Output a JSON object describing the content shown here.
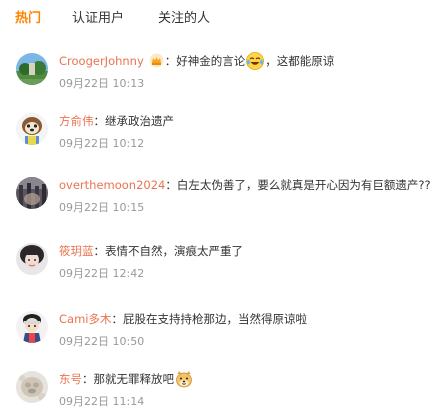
{
  "tabs": [
    {
      "label": "热门",
      "active": true
    },
    {
      "label": "认证用户",
      "active": false
    },
    {
      "label": "关注的人",
      "active": false
    }
  ],
  "comments": [
    {
      "username": "CroogerJohnny",
      "colon": "：",
      "text_before": "好神金的言论",
      "text_after": "，这都能原谅",
      "badge_icon": "crown-badge-icon",
      "emoji_icon": "laughing-tears-emoji-icon",
      "time": "09月22日 10:13"
    },
    {
      "username": "方俞伟",
      "colon": "：",
      "text_before": "继承政治遗产",
      "time": "09月22日 10:12"
    },
    {
      "username": "overthemoon2024",
      "colon": "：",
      "text_before": "白左太伪善了，要么就真是开心因为有巨额遗产??",
      "time": "09月22日 10:15"
    },
    {
      "username": "筱玥蓝",
      "colon": "：",
      "text_before": "表情不自然，演痕太严重了",
      "time": "09月22日 12:42"
    },
    {
      "username": "Cami多木",
      "colon": "：",
      "text_before": "屁股在支持持枪那边，当然得原谅啦",
      "time": "09月22日 10:50"
    },
    {
      "username": "东号",
      "colon": "：",
      "text_before": "那就无罪释放吧",
      "emoji_icon": "doge-emoji-icon",
      "time": "09月22日 11:14"
    }
  ],
  "colors": {
    "tab_active": "#ff8200",
    "username": "#eb7350",
    "text": "#333333",
    "time": "#999999"
  }
}
